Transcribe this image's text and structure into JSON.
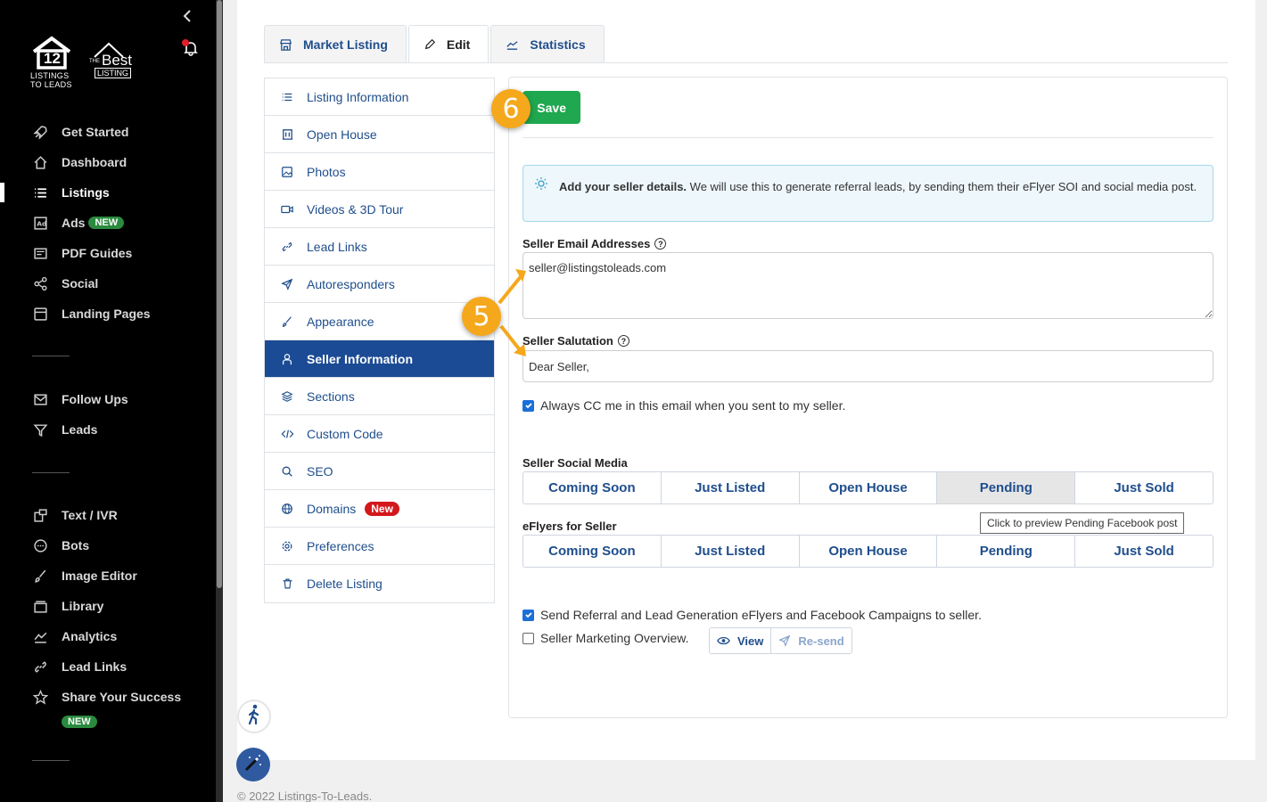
{
  "sidebar": {
    "logo1": {
      "number": "12",
      "caption_line1": "LISTINGS",
      "caption_line2": "TO LEADS"
    },
    "logo2": {
      "small": "THE",
      "word": "Best",
      "sub": "LISTING"
    },
    "items": [
      {
        "label": "Get Started",
        "icon": "rocket-icon"
      },
      {
        "label": "Dashboard",
        "icon": "home-icon"
      },
      {
        "label": "Listings",
        "icon": "list-icon"
      },
      {
        "label": "Ads",
        "icon": "ad-icon",
        "badge": "NEW"
      },
      {
        "label": "PDF Guides",
        "icon": "pdf-icon"
      },
      {
        "label": "Social",
        "icon": "share-icon"
      },
      {
        "label": "Landing Pages",
        "icon": "page-icon"
      },
      {
        "label": "Follow Ups",
        "icon": "mail-icon"
      },
      {
        "label": "Leads",
        "icon": "filter-icon"
      },
      {
        "label": "Text / IVR",
        "icon": "phone-message-icon"
      },
      {
        "label": "Bots",
        "icon": "chat-icon"
      },
      {
        "label": "Image Editor",
        "icon": "brush-icon"
      },
      {
        "label": "Library",
        "icon": "library-icon"
      },
      {
        "label": "Analytics",
        "icon": "chart-icon"
      },
      {
        "label": "Lead Links",
        "icon": "link-icon"
      },
      {
        "label": "Share Your Success",
        "icon": "star-icon",
        "badge": "NEW"
      }
    ]
  },
  "tabs": [
    {
      "label": "Market Listing",
      "icon": "store-icon"
    },
    {
      "label": "Edit",
      "icon": "pencil-icon"
    },
    {
      "label": "Statistics",
      "icon": "chart-line-icon"
    }
  ],
  "menu": [
    {
      "label": "Listing Information",
      "icon": "list-icon"
    },
    {
      "label": "Open House",
      "icon": "building-icon"
    },
    {
      "label": "Photos",
      "icon": "image-icon"
    },
    {
      "label": "Videos & 3D Tour",
      "icon": "video-icon"
    },
    {
      "label": "Lead Links",
      "icon": "link-icon"
    },
    {
      "label": "Autoresponders",
      "icon": "send-icon"
    },
    {
      "label": "Appearance",
      "icon": "brush-icon"
    },
    {
      "label": "Seller Information",
      "icon": "user-icon"
    },
    {
      "label": "Sections",
      "icon": "layers-icon"
    },
    {
      "label": "Custom Code",
      "icon": "code-icon"
    },
    {
      "label": "SEO",
      "icon": "search-icon"
    },
    {
      "label": "Domains",
      "icon": "globe-icon",
      "badge": "New"
    },
    {
      "label": "Preferences",
      "icon": "gear-icon"
    },
    {
      "label": "Delete Listing",
      "icon": "trash-icon"
    }
  ],
  "form": {
    "save_label": "Save",
    "info_bold": "Add your seller details.",
    "info_rest": " We will use this to generate referral leads, by sending them their eFlyer SOI and social media post.",
    "email_label": "Seller Email Addresses",
    "email_value": "seller@listingstoleads.com",
    "salutation_label": "Seller Salutation",
    "salutation_value": "Dear Seller,",
    "cc_label": "Always CC me in this email when you sent to my seller.",
    "social_label": "Seller Social Media",
    "social_buttons": [
      "Coming Soon",
      "Just Listed",
      "Open House",
      "Pending",
      "Just Sold"
    ],
    "tooltip": "Click to preview Pending Facebook post",
    "eflyers_label": "eFlyers for Seller",
    "eflyer_buttons": [
      "Coming Soon",
      "Just Listed",
      "Open House",
      "Pending",
      "Just Sold"
    ],
    "referral_label": "Send Referral and Lead Generation eFlyers and Facebook Campaigns to seller.",
    "overview_label": "Seller Marketing Overview.",
    "view_label": "View",
    "resend_label": "Re-send",
    "cc_checked": true,
    "referral_checked": true,
    "overview_checked": false
  },
  "steps": {
    "five": "5",
    "six": "6"
  },
  "footer": "© 2022 Listings-To-Leads.",
  "colors": {
    "sidebar_bg": "#000000",
    "accent_blue": "#1b4b94",
    "save_green": "#1fa84f",
    "badge_green": "#2a8a3e",
    "badge_red": "#d4171b",
    "step_orange": "#f5a81c"
  }
}
